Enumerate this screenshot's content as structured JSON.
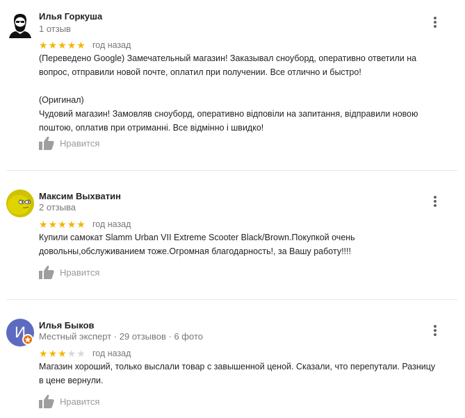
{
  "reviews": [
    {
      "author": "Илья Горкуша",
      "meta": "1 отзыв",
      "rating": 5,
      "time": "год назад",
      "text_lines": [
        "(Переведено Google) Замечательный магазин! Заказывал сноуборд, оперативно ответили на",
        "вопрос, отправили новой почте, оплатил при получении. Все отлично и быстро!",
        "",
        "(Оригинал)",
        "Чудовий магазин! Замовляв сноуборд, оперативно відповіли на запитання, відправили новою",
        "поштою, оплатив при отриманні. Все відмінно і швидко!"
      ],
      "like_label": "Нравится",
      "avatar_icon": "bearded-man-avatar-icon"
    },
    {
      "author": "Максим Выхватин",
      "meta": "2 отзыва",
      "rating": 5,
      "time": "год назад",
      "text_lines": [
        "Купили самокат Slamm Urban VII Extreme Scooter Black/Brown.Покупкой очень",
        "довольны,обслуживанием тоже.Огромная благодарность!, за Вашу работу!!!!"
      ],
      "like_label": "Нравится",
      "avatar_icon": "yellow-character-avatar-icon"
    },
    {
      "author": "Илья Быков",
      "meta": "Местный эксперт · 29 отзывов · 6 фото",
      "rating": 3,
      "time": "год назад",
      "text_lines": [
        "Магазин хороший, только выслали товар с завышенной ценой. Сказали, что перепутали. Разницу",
        "в цене вернули."
      ],
      "like_label": "Нравится",
      "avatar_letter": "И",
      "avatar_color": "#5c6bc0",
      "badge_color": "#e8710a"
    }
  ],
  "colors": {
    "star_on": "#f5b400",
    "star_off": "#d8d8d8",
    "muted_text": "#777777",
    "like_icon": "#9e9e9e"
  }
}
